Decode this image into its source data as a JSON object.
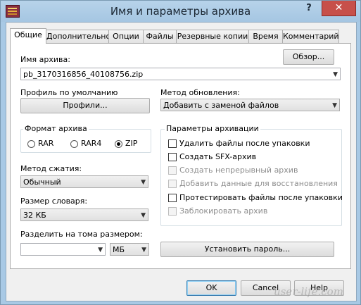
{
  "window": {
    "title": "Имя и параметры архива",
    "help_label": "?",
    "close_label": "✕"
  },
  "tabs": [
    "Общие",
    "Дополнительно",
    "Опции",
    "Файлы",
    "Резервные копии",
    "Время",
    "Комментарий"
  ],
  "archive_name": {
    "label": "Имя архива:",
    "browse": "Обзор...",
    "value": "pb_3170316856_40108756.zip"
  },
  "profile": {
    "label": "Профиль по умолчанию",
    "button": "Профили..."
  },
  "update_method": {
    "label": "Метод обновления:",
    "value": "Добавить с заменой файлов"
  },
  "archive_format": {
    "label": "Формат архива",
    "options": [
      "RAR",
      "RAR4",
      "ZIP"
    ],
    "selected": "ZIP"
  },
  "archive_options": {
    "label": "Параметры архивации",
    "items": [
      {
        "label": "Удалить файлы после упаковки",
        "checked": false,
        "enabled": true
      },
      {
        "label": "Создать SFX-архив",
        "checked": false,
        "enabled": true
      },
      {
        "label": "Создать непрерывный архив",
        "checked": false,
        "enabled": false
      },
      {
        "label": "Добавить данные для восстановления",
        "checked": false,
        "enabled": false
      },
      {
        "label": "Протестировать файлы после упаковки",
        "checked": false,
        "enabled": true
      },
      {
        "label": "Заблокировать архив",
        "checked": false,
        "enabled": false
      }
    ]
  },
  "compression": {
    "label": "Метод сжатия:",
    "value": "Обычный"
  },
  "dictionary": {
    "label": "Размер словаря:",
    "value": "32 КБ"
  },
  "split": {
    "label": "Разделить на тома размером:",
    "value": "",
    "unit": "МБ"
  },
  "set_password": "Установить пароль...",
  "footer": {
    "ok": "OK",
    "cancel": "Cancel",
    "help": "Help"
  },
  "watermark": "user-life.com"
}
